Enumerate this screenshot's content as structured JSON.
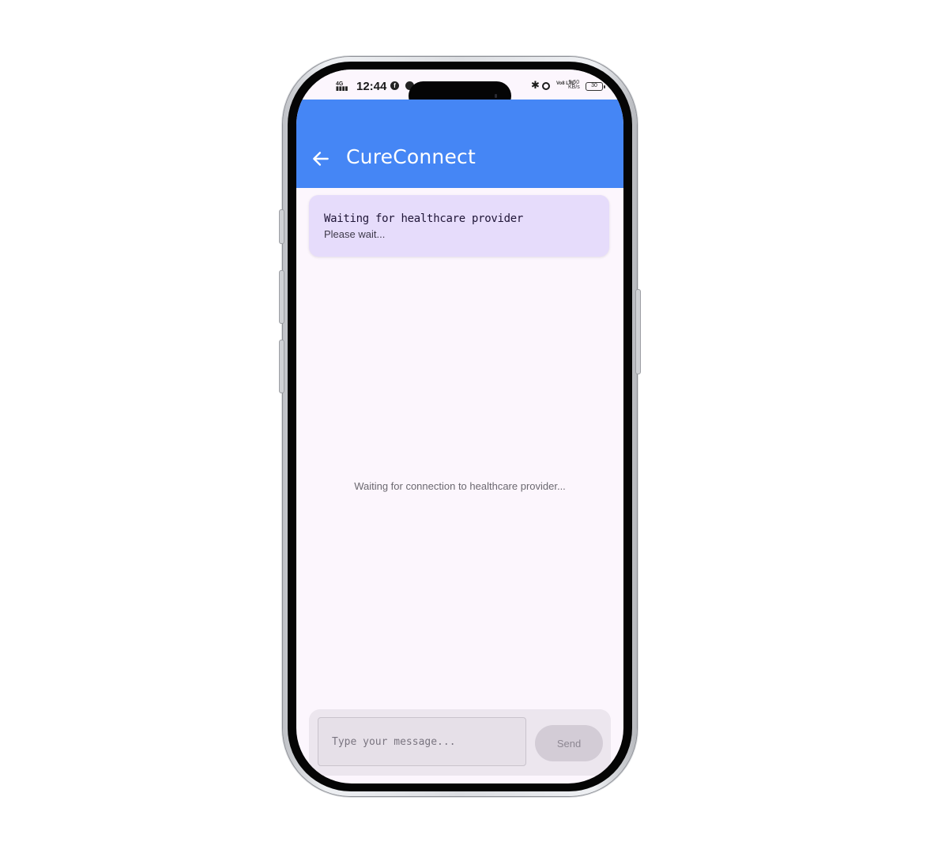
{
  "status_bar": {
    "network": "4G",
    "time": "12:44",
    "facebook_icon": "facebook-icon",
    "whatsapp_icon": "whatsapp-icon",
    "bluetooth_icon": "bluetooth-icon",
    "alarm_icon": "alarm-icon",
    "volte": "Vo8 LTE",
    "speed_value": "5.50",
    "speed_unit": "KB/s",
    "battery": "30"
  },
  "appbar": {
    "title": "CureConnect",
    "back_icon": "arrow-left-icon"
  },
  "status_card": {
    "title": "Waiting for healthcare provider",
    "subtitle": "Please wait..."
  },
  "chat": {
    "empty_message": "Waiting for connection to healthcare provider..."
  },
  "composer": {
    "placeholder": "Type your message...",
    "send_label": "Send"
  },
  "colors": {
    "appbar": "#4586f5",
    "screen_bg": "#fcf6fd",
    "card_bg": "#e6dcfb",
    "composer_bg": "#ece6ee"
  }
}
